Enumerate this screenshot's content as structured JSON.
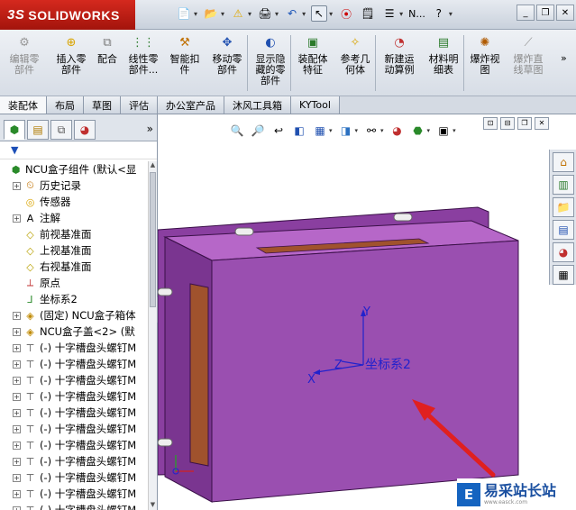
{
  "app": {
    "brand": "SOLIDWORKS",
    "brand_mark": "3S",
    "title_short": "N..."
  },
  "command_manager": {
    "buttons": [
      {
        "label": "编辑零\n部件",
        "icon": "edit-component-icon",
        "enabled": false
      },
      {
        "label": "插入零\n部件",
        "icon": "insert-component-icon",
        "enabled": true
      },
      {
        "label": "配合",
        "icon": "mate-icon",
        "enabled": true
      },
      {
        "label": "线性零\n部件...",
        "icon": "linear-pattern-icon",
        "enabled": true
      },
      {
        "label": "智能扣\n件",
        "icon": "smart-fastener-icon",
        "enabled": true
      },
      {
        "label": "移动零\n部件",
        "icon": "move-component-icon",
        "enabled": true
      },
      {
        "label": "显示隐\n藏的零\n部件",
        "icon": "show-hidden-icon",
        "enabled": true
      },
      {
        "label": "装配体\n特征",
        "icon": "assembly-feature-icon",
        "enabled": true
      },
      {
        "label": "参考几\n何体",
        "icon": "reference-geometry-icon",
        "enabled": true
      },
      {
        "label": "新建运\n动算例",
        "icon": "new-motion-study-icon",
        "enabled": true
      },
      {
        "label": "材料明\n细表",
        "icon": "bom-icon",
        "enabled": true
      },
      {
        "label": "爆炸视\n图",
        "icon": "exploded-view-icon",
        "enabled": true
      },
      {
        "label": "爆炸直\n线草图",
        "icon": "explode-line-sketch-icon",
        "enabled": false
      }
    ],
    "more": "»"
  },
  "tabs": [
    "装配体",
    "布局",
    "草图",
    "评估",
    "办公室产品",
    "沐风工具箱",
    "KYTool"
  ],
  "active_tab": 0,
  "feature_tree": {
    "more": "»",
    "filter_icon": "▼",
    "nodes": [
      {
        "label": "NCU盒子组件  (默认<显",
        "icon": "assembly-icon",
        "expand": "",
        "indent": 0
      },
      {
        "label": "历史记录",
        "icon": "history-icon",
        "expand": "+",
        "indent": 1
      },
      {
        "label": "传感器",
        "icon": "sensor-icon",
        "expand": "",
        "indent": 1
      },
      {
        "label": "注解",
        "icon": "annotation-icon",
        "expand": "+",
        "indent": 1
      },
      {
        "label": "前视基准面",
        "icon": "plane-icon",
        "expand": "",
        "indent": 1
      },
      {
        "label": "上视基准面",
        "icon": "plane-icon",
        "expand": "",
        "indent": 1
      },
      {
        "label": "右视基准面",
        "icon": "plane-icon",
        "expand": "",
        "indent": 1
      },
      {
        "label": "原点",
        "icon": "origin-icon",
        "expand": "",
        "indent": 1
      },
      {
        "label": "坐标系2",
        "icon": "coordinate-system-icon",
        "expand": "",
        "indent": 1
      },
      {
        "label": "(固定) NCU盒子箱体",
        "icon": "part-icon",
        "expand": "+",
        "indent": 1
      },
      {
        "label": "NCU盒子盖<2> (默",
        "icon": "part-icon",
        "expand": "+",
        "indent": 1
      },
      {
        "label": "(-) 十字槽盘头螺钉M",
        "icon": "screw-icon",
        "expand": "+",
        "indent": 1
      },
      {
        "label": "(-) 十字槽盘头螺钉M",
        "icon": "screw-icon",
        "expand": "+",
        "indent": 1
      },
      {
        "label": "(-) 十字槽盘头螺钉M",
        "icon": "screw-icon",
        "expand": "+",
        "indent": 1
      },
      {
        "label": "(-) 十字槽盘头螺钉M",
        "icon": "screw-icon",
        "expand": "+",
        "indent": 1
      },
      {
        "label": "(-) 十字槽盘头螺钉M",
        "icon": "screw-icon",
        "expand": "+",
        "indent": 1
      },
      {
        "label": "(-) 十字槽盘头螺钉M",
        "icon": "screw-icon",
        "expand": "+",
        "indent": 1
      },
      {
        "label": "(-) 十字槽盘头螺钉M",
        "icon": "screw-icon",
        "expand": "+",
        "indent": 1
      },
      {
        "label": "(-) 十字槽盘头螺钉M",
        "icon": "screw-icon",
        "expand": "+",
        "indent": 1
      },
      {
        "label": "(-) 十字槽盘头螺钉M",
        "icon": "screw-icon",
        "expand": "+",
        "indent": 1
      },
      {
        "label": "(-) 十字槽盘头螺钉M",
        "icon": "screw-icon",
        "expand": "+",
        "indent": 1
      },
      {
        "label": "(-) 十字槽盘头螺钉M",
        "icon": "screw-icon",
        "expand": "+",
        "indent": 1
      }
    ]
  },
  "viewport": {
    "coord_label": "坐标系2",
    "axis_x": "X",
    "axis_y": "Y",
    "axis_z": "Z",
    "colors": {
      "box_face": "#9a4fb0",
      "box_top": "#b667c8",
      "box_side": "#7a3590",
      "slot": "#a0522d",
      "axis": "#2222cc",
      "arrow": "#e02020"
    }
  },
  "watermark": {
    "logo": "E",
    "text": "易采站长站",
    "sub": "www.easck.com"
  }
}
